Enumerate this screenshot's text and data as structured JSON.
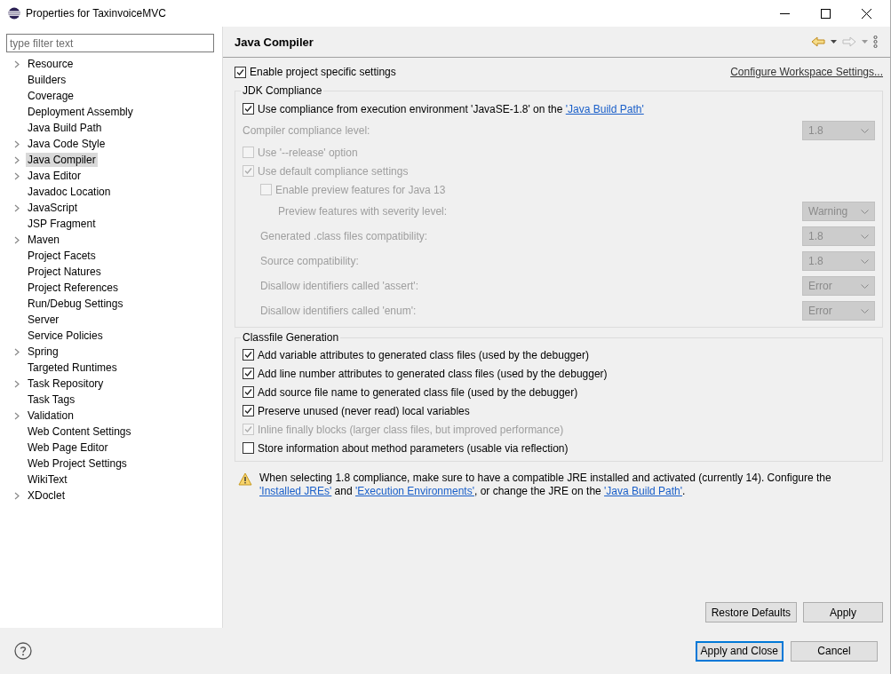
{
  "window": {
    "title": "Properties for TaxinvoiceMVC"
  },
  "filter": {
    "placeholder": "type filter text"
  },
  "tree": [
    {
      "label": "Resource",
      "kind": "group",
      "selected": false
    },
    {
      "label": "Builders",
      "kind": "leaf",
      "selected": false
    },
    {
      "label": "Coverage",
      "kind": "leaf",
      "selected": false
    },
    {
      "label": "Deployment Assembly",
      "kind": "leaf",
      "selected": false
    },
    {
      "label": "Java Build Path",
      "kind": "leaf",
      "selected": false
    },
    {
      "label": "Java Code Style",
      "kind": "group",
      "selected": false
    },
    {
      "label": "Java Compiler",
      "kind": "group",
      "selected": true
    },
    {
      "label": "Java Editor",
      "kind": "group",
      "selected": false
    },
    {
      "label": "Javadoc Location",
      "kind": "leaf",
      "selected": false
    },
    {
      "label": "JavaScript",
      "kind": "group",
      "selected": false
    },
    {
      "label": "JSP Fragment",
      "kind": "leaf",
      "selected": false
    },
    {
      "label": "Maven",
      "kind": "group",
      "selected": false
    },
    {
      "label": "Project Facets",
      "kind": "leaf",
      "selected": false
    },
    {
      "label": "Project Natures",
      "kind": "leaf",
      "selected": false
    },
    {
      "label": "Project References",
      "kind": "leaf",
      "selected": false
    },
    {
      "label": "Run/Debug Settings",
      "kind": "leaf",
      "selected": false
    },
    {
      "label": "Server",
      "kind": "leaf",
      "selected": false
    },
    {
      "label": "Service Policies",
      "kind": "leaf",
      "selected": false
    },
    {
      "label": "Spring",
      "kind": "group",
      "selected": false
    },
    {
      "label": "Targeted Runtimes",
      "kind": "leaf",
      "selected": false
    },
    {
      "label": "Task Repository",
      "kind": "group",
      "selected": false
    },
    {
      "label": "Task Tags",
      "kind": "leaf",
      "selected": false
    },
    {
      "label": "Validation",
      "kind": "group",
      "selected": false
    },
    {
      "label": "Web Content Settings",
      "kind": "leaf",
      "selected": false
    },
    {
      "label": "Web Page Editor",
      "kind": "leaf",
      "selected": false
    },
    {
      "label": "Web Project Settings",
      "kind": "leaf",
      "selected": false
    },
    {
      "label": "WikiText",
      "kind": "leaf",
      "selected": false
    },
    {
      "label": "XDoclet",
      "kind": "group",
      "selected": false
    }
  ],
  "page": {
    "title": "Java Compiler"
  },
  "enable_specific": {
    "label": "Enable project specific settings",
    "checked": true
  },
  "configure_link": "Configure Workspace Settings...",
  "jdk_group": {
    "title": "JDK Compliance",
    "rows": [
      {
        "kind": "checkbox",
        "label": "Use compliance from execution environment 'JavaSE-1.8' on the ",
        "link": "'Java Build Path'",
        "checked": true,
        "disabled": false
      },
      {
        "kind": "combo",
        "label": "Compiler compliance level:",
        "value": "1.8",
        "disabled": true
      },
      {
        "kind": "checkbox",
        "label": "Use '--release' option",
        "checked": false,
        "disabled": true
      },
      {
        "kind": "checkbox",
        "label": "Use default compliance settings",
        "checked": true,
        "disabled": true,
        "children": [
          {
            "kind": "checkbox",
            "label": "Enable preview features for Java 13",
            "checked": false,
            "disabled": true,
            "children": [
              {
                "kind": "combo",
                "label": "Preview features with severity level:",
                "value": "Warning",
                "disabled": true
              }
            ]
          },
          {
            "kind": "combo",
            "label": "Generated .class files compatibility:",
            "value": "1.8",
            "disabled": true
          },
          {
            "kind": "combo",
            "label": "Source compatibility:",
            "value": "1.8",
            "disabled": true
          },
          {
            "kind": "combo",
            "label": "Disallow identifiers called 'assert':",
            "value": "Error",
            "disabled": true
          },
          {
            "kind": "combo",
            "label": "Disallow identifiers called 'enum':",
            "value": "Error",
            "disabled": true
          }
        ]
      }
    ]
  },
  "classfile_group": {
    "title": "Classfile Generation",
    "options": [
      {
        "label": "Add variable attributes to generated class files (used by the debugger)",
        "checked": true,
        "disabled": false
      },
      {
        "label": "Add line number attributes to generated class files (used by the debugger)",
        "checked": true,
        "disabled": false
      },
      {
        "label": "Add source file name to generated class file (used by the debugger)",
        "checked": true,
        "disabled": false
      },
      {
        "label": "Preserve unused (never read) local variables",
        "checked": true,
        "disabled": false
      },
      {
        "label": "Inline finally blocks (larger class files, but improved performance)",
        "checked": true,
        "disabled": true
      },
      {
        "label": "Store information about method parameters (usable via reflection)",
        "checked": false,
        "disabled": false
      }
    ]
  },
  "warning": [
    {
      "kind": "text",
      "text": "When selecting 1.8 compliance, make sure to have a compatible JRE installed and activated (currently 14). Configure the "
    },
    {
      "kind": "link",
      "text": "'Installed JREs'"
    },
    {
      "kind": "text",
      "text": " and "
    },
    {
      "kind": "link",
      "text": "'Execution Environments'"
    },
    {
      "kind": "text",
      "text": ", or change the JRE on the "
    },
    {
      "kind": "link",
      "text": "'Java Build Path'"
    },
    {
      "kind": "text",
      "text": "."
    }
  ],
  "page_buttons": [
    "Restore Defaults",
    "Apply"
  ],
  "dialog_buttons": [
    {
      "label": "Apply and Close",
      "default": true
    },
    {
      "label": "Cancel",
      "default": false
    }
  ]
}
